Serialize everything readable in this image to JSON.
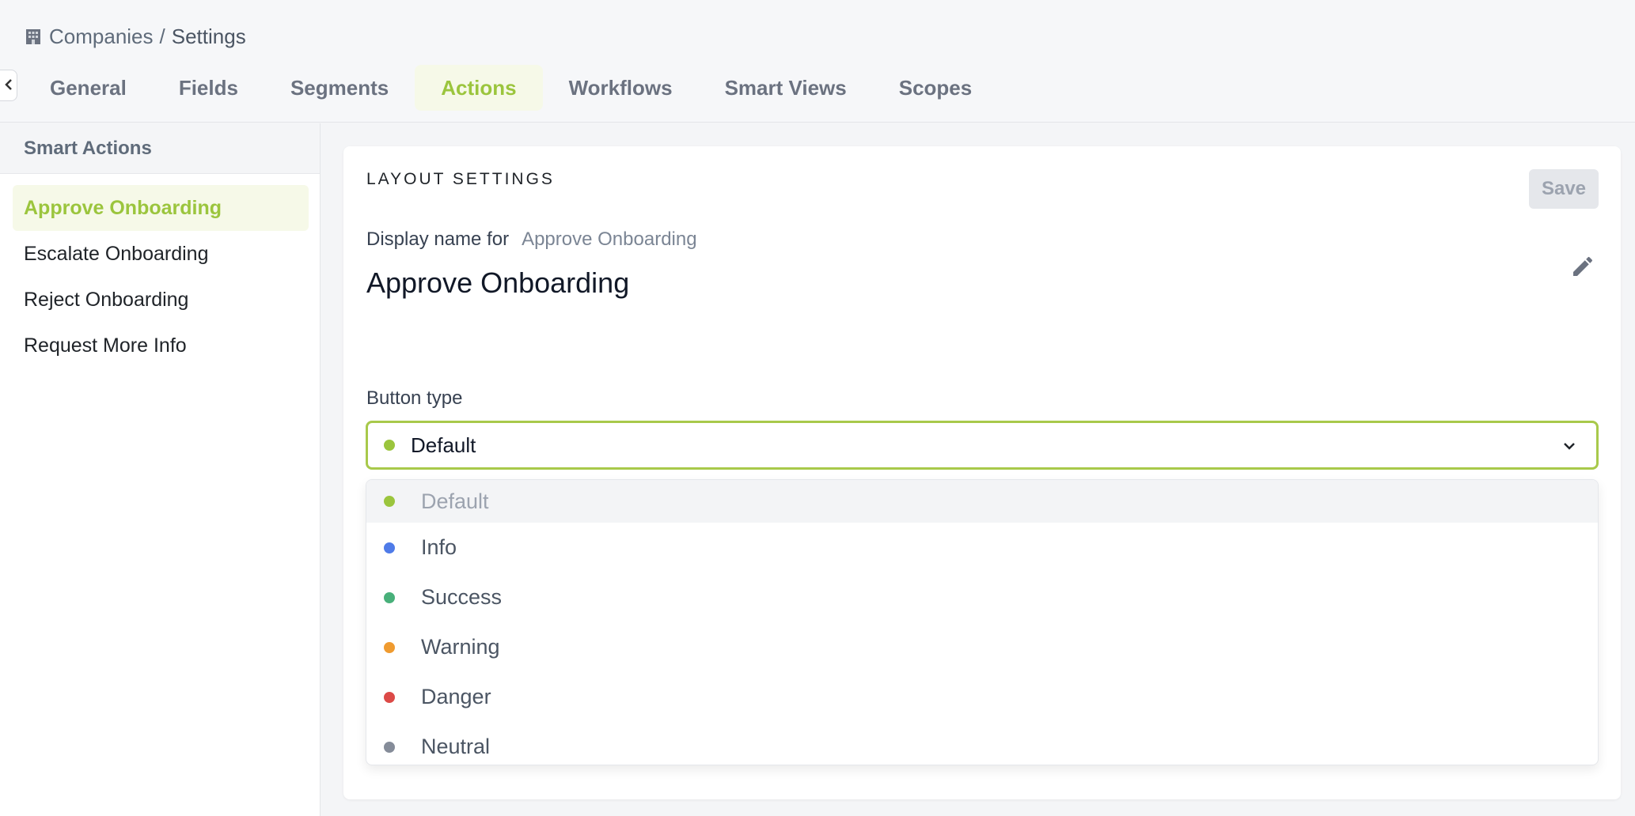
{
  "breadcrumb": {
    "icon": "building-icon",
    "parent": "Companies",
    "separator": "/",
    "current": "Settings"
  },
  "tabs": [
    {
      "label": "General",
      "active": false
    },
    {
      "label": "Fields",
      "active": false
    },
    {
      "label": "Segments",
      "active": false
    },
    {
      "label": "Actions",
      "active": true
    },
    {
      "label": "Workflows",
      "active": false
    },
    {
      "label": "Smart Views",
      "active": false
    },
    {
      "label": "Scopes",
      "active": false
    }
  ],
  "sidebar": {
    "title": "Smart Actions",
    "items": [
      {
        "label": "Approve Onboarding",
        "active": true
      },
      {
        "label": "Escalate Onboarding",
        "active": false
      },
      {
        "label": "Reject Onboarding",
        "active": false
      },
      {
        "label": "Request More Info",
        "active": false
      }
    ]
  },
  "card": {
    "title": "LAYOUT SETTINGS",
    "save_label": "Save",
    "display_label": "Display name for",
    "display_for": "Approve Onboarding",
    "display_value": "Approve Onboarding",
    "button_type_label": "Button type",
    "selected_type": "Default"
  },
  "dropdown": {
    "options": [
      {
        "label": "Default",
        "color": "#9bc53d",
        "selected": true
      },
      {
        "label": "Info",
        "color": "#4f7be8",
        "selected": false
      },
      {
        "label": "Success",
        "color": "#48b07a",
        "selected": false
      },
      {
        "label": "Warning",
        "color": "#ef9b30",
        "selected": false
      },
      {
        "label": "Danger",
        "color": "#dc4a47",
        "selected": false
      },
      {
        "label": "Neutral",
        "color": "#858c99",
        "selected": false
      }
    ]
  },
  "colors": {
    "accent": "#9bc53d",
    "accent_bg": "#f6f9e8",
    "select_border": "#a8c94b"
  }
}
